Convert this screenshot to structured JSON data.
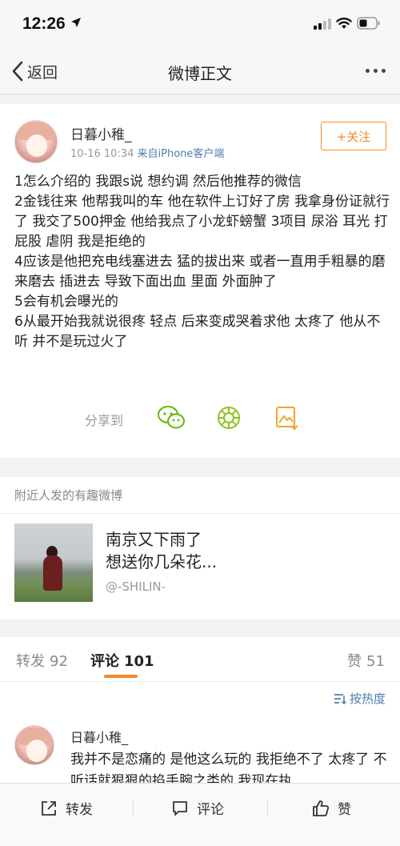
{
  "status": {
    "time": "12:26"
  },
  "nav": {
    "back_label": "返回",
    "title": "微博正文"
  },
  "post": {
    "username": "日暮小稚_",
    "time": "10-16 10:34",
    "source": "来自iPhone客户端",
    "follow_label": "+关注",
    "lines": [
      "1怎么介绍的 我跟s说 想约调 然后他推荐的微信",
      "2金钱往来 他帮我叫的车 他在软件上订好了房 我拿身份证就行了 我交了500押金 他给我点了小龙虾螃蟹 3项目 尿浴 耳光 打屁股 虐阴 我是拒绝的",
      "4应该是他把充电线塞进去 猛的拔出来 或者一直用手粗暴的磨来磨去 插进去 导致下面出血 里面 外面肿了",
      "5会有机会曝光的",
      "6从最开始我就说很疼 轻点 后来变成哭着求他 太疼了 他从不听 并不是玩过火了"
    ],
    "share_label": "分享到"
  },
  "nearby": {
    "header": "附近人发的有趣微博",
    "title_line1": "南京又下雨了",
    "title_line2": "想送你几朵花...",
    "author": "@-SHILIN-"
  },
  "tabs": {
    "repost_label": "转发",
    "repost_count": "92",
    "comment_label": "评论",
    "comment_count": "101",
    "like_label": "赞",
    "like_count": "51"
  },
  "comments": {
    "sort_label": "按热度",
    "first": {
      "username": "日暮小稚_",
      "text": "我并不是恋痛的 是他这么玩的 我拒绝不了 太疼了 不听话就狠狠的掐手腕之类的 我现在执"
    }
  },
  "bottombar": {
    "repost": "转发",
    "comment": "评论",
    "like": "赞"
  },
  "colors": {
    "accent": "#f28a2b",
    "link": "#507daf"
  }
}
